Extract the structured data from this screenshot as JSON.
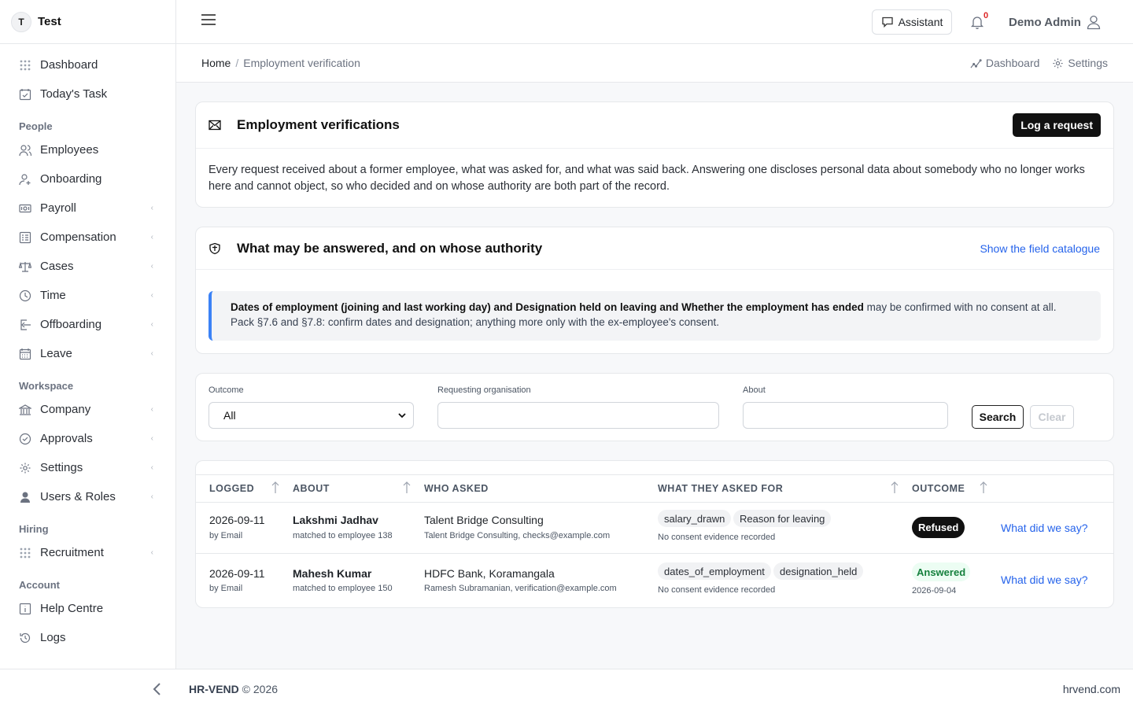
{
  "brand": {
    "initial": "T",
    "name": "Test"
  },
  "sidebar": {
    "items": [
      {
        "label": "Dashboard",
        "icon": "grid-icon"
      },
      {
        "label": "Today's Task",
        "icon": "calendar-check-icon"
      }
    ],
    "sections": [
      {
        "title": "People",
        "items": [
          {
            "label": "Employees",
            "icon": "users-icon",
            "chevron": false
          },
          {
            "label": "Onboarding",
            "icon": "user-plus-icon",
            "chevron": false
          },
          {
            "label": "Payroll",
            "icon": "money-icon",
            "chevron": true
          },
          {
            "label": "Compensation",
            "icon": "table-icon",
            "chevron": true
          },
          {
            "label": "Cases",
            "icon": "scale-icon",
            "chevron": true
          },
          {
            "label": "Time",
            "icon": "clock-icon",
            "chevron": true
          },
          {
            "label": "Offboarding",
            "icon": "exit-icon",
            "chevron": true
          },
          {
            "label": "Leave",
            "icon": "calendar-icon",
            "chevron": true
          }
        ]
      },
      {
        "title": "Workspace",
        "items": [
          {
            "label": "Company",
            "icon": "bank-icon",
            "chevron": true
          },
          {
            "label": "Approvals",
            "icon": "check-circle-icon",
            "chevron": true
          },
          {
            "label": "Settings",
            "icon": "gear-icon",
            "chevron": true
          },
          {
            "label": "Users & Roles",
            "icon": "user-shield-icon",
            "chevron": true
          }
        ]
      },
      {
        "title": "Hiring",
        "items": [
          {
            "label": "Recruitment",
            "icon": "grid-icon",
            "chevron": true
          }
        ]
      },
      {
        "title": "Account",
        "items": [
          {
            "label": "Help Centre",
            "icon": "info-icon",
            "chevron": false
          },
          {
            "label": "Logs",
            "icon": "history-icon",
            "chevron": false
          }
        ]
      }
    ]
  },
  "topbar": {
    "assistant_label": "Assistant",
    "notification_count": "0",
    "user_name": "Demo Admin"
  },
  "breadcrumb": {
    "home": "Home",
    "separator": "/",
    "current": "Employment verification",
    "actions": {
      "dashboard": "Dashboard",
      "settings": "Settings"
    }
  },
  "verifications_card": {
    "title": "Employment verifications",
    "button": "Log a request",
    "description": "Every request received about a former employee, what was asked for, and what was said back. Answering one discloses personal data about somebody who no longer works here and cannot object, so who decided and on whose authority are both part of the record."
  },
  "authority_card": {
    "title": "What may be answered, and on whose authority",
    "link": "Show the field catalogue",
    "callout_bold": "Dates of employment (joining and last working day) and Designation held on leaving and Whether the employment has ended",
    "callout_rest": " may be confirmed with no consent at all. Pack §7.6 and §7.8: confirm dates and designation; anything more only with the ex-employee's consent."
  },
  "filters": {
    "outcome_label": "Outcome",
    "outcome_value": "All",
    "org_label": "Requesting organisation",
    "org_value": "",
    "about_label": "About",
    "about_value": "",
    "search": "Search",
    "clear": "Clear"
  },
  "table": {
    "headers": {
      "logged": "LOGGED",
      "about": "ABOUT",
      "who": "WHO ASKED",
      "what": "WHAT THEY ASKED FOR",
      "outcome": "OUTCOME"
    },
    "rows": [
      {
        "date": "2026-09-11",
        "via": "by Email",
        "name": "Lakshmi Jadhav",
        "match": "matched to employee 138",
        "org": "Talent Bridge Consulting",
        "contact": "Talent Bridge Consulting, checks@example.com",
        "chips": [
          "salary_drawn",
          "Reason for leaving"
        ],
        "consent": "No consent evidence recorded",
        "outcome": "Refused",
        "outcome_date": "",
        "link": "What did we say?"
      },
      {
        "date": "2026-09-11",
        "via": "by Email",
        "name": "Mahesh Kumar",
        "match": "matched to employee 150",
        "org": "HDFC Bank, Koramangala",
        "contact": "Ramesh Subramanian, verification@example.com",
        "chips": [
          "dates_of_employment",
          "designation_held"
        ],
        "consent": "No consent evidence recorded",
        "outcome": "Answered",
        "outcome_date": "2026-09-04",
        "link": "What did we say?"
      }
    ]
  },
  "footer": {
    "brand": "HR-VEND",
    "copyright": "© 2026",
    "site": "hrvend.com"
  },
  "colors": {
    "accent": "#2563eb",
    "callout_border": "#3b82f6",
    "refused": "#111111",
    "answered": "#15803d",
    "badge": "#dc2626"
  }
}
